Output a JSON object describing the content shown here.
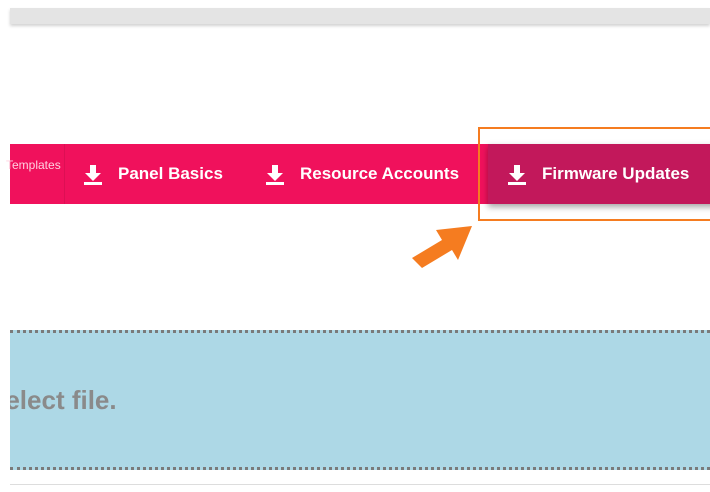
{
  "tabs": {
    "partial_label": "Templates",
    "panel_basics": "Panel Basics",
    "resource_accounts": "Resource Accounts",
    "firmware_updates": "Firmware Updates"
  },
  "drop_zone": {
    "text": "Select file."
  },
  "colors": {
    "tab_bar": "#f0115c",
    "tab_active": "#c2185b",
    "highlight": "#f57c20",
    "drop_zone": "#add8e6"
  },
  "icons": {
    "tab_icon": "download-icon",
    "annotation": "arrow-up-right-icon"
  }
}
